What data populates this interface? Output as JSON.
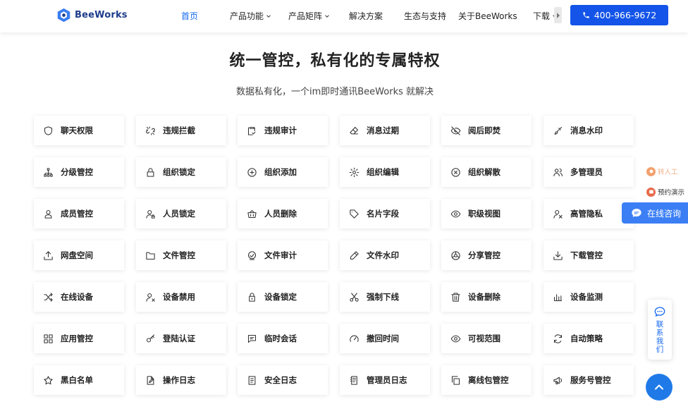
{
  "nav": {
    "brand": "BeeWorks",
    "items": [
      {
        "label": "首页",
        "active": true,
        "dropdown": false
      },
      {
        "label": "产品功能",
        "active": false,
        "dropdown": true
      },
      {
        "label": "产品矩阵",
        "active": false,
        "dropdown": true
      },
      {
        "label": "解决方案",
        "active": false,
        "dropdown": false
      },
      {
        "label": "生态与支持",
        "active": false,
        "dropdown": false
      },
      {
        "label": "关于BeeWorks",
        "active": false,
        "dropdown": false
      },
      {
        "label": "下载",
        "active": false,
        "dropdown": true
      }
    ],
    "phone": "400-966-9672",
    "accent": "#1454e8"
  },
  "hero": {
    "title": "统一管控，私有化的专属特权",
    "subtitle": "数据私有化，一个im即时通讯BeeWorks 就解决"
  },
  "features": [
    [
      {
        "label": "聊天权限",
        "icon": "shield-icon"
      },
      {
        "label": "违规拦截",
        "icon": "broken-link-icon"
      },
      {
        "label": "违规审计",
        "icon": "clipboard-check-icon"
      },
      {
        "label": "消息过期",
        "icon": "eraser-icon"
      },
      {
        "label": "阅后即焚",
        "icon": "eye-off-icon"
      },
      {
        "label": "消息水印",
        "icon": "brush-icon"
      }
    ],
    [
      {
        "label": "分级管控",
        "icon": "hierarchy-icon"
      },
      {
        "label": "组织锁定",
        "icon": "lock-icon"
      },
      {
        "label": "组织添加",
        "icon": "plus-circle-icon"
      },
      {
        "label": "组织编辑",
        "icon": "gear-icon"
      },
      {
        "label": "组织解散",
        "icon": "x-circle-icon"
      },
      {
        "label": "多管理员",
        "icon": "users-icon"
      }
    ],
    [
      {
        "label": "成员管控",
        "icon": "user-badge-icon"
      },
      {
        "label": "人员锁定",
        "icon": "user-lock-icon"
      },
      {
        "label": "人员删除",
        "icon": "basket-icon"
      },
      {
        "label": "名片字段",
        "icon": "tag-icon"
      },
      {
        "label": "职级视图",
        "icon": "eye-icon"
      },
      {
        "label": "高管隐私",
        "icon": "user-hide-icon"
      }
    ],
    [
      {
        "label": "网盘空间",
        "icon": "upload-icon"
      },
      {
        "label": "文件管控",
        "icon": "folder-icon"
      },
      {
        "label": "文件审计",
        "icon": "audit-icon"
      },
      {
        "label": "文件水印",
        "icon": "pencil-icon"
      },
      {
        "label": "分享管控",
        "icon": "share-icon"
      },
      {
        "label": "下载管控",
        "icon": "download-icon"
      }
    ],
    [
      {
        "label": "在线设备",
        "icon": "shuffle-icon"
      },
      {
        "label": "设备禁用",
        "icon": "user-x-icon"
      },
      {
        "label": "设备锁定",
        "icon": "padlock-icon"
      },
      {
        "label": "强制下线",
        "icon": "scissors-icon"
      },
      {
        "label": "设备删除",
        "icon": "trash-icon"
      },
      {
        "label": "设备监测",
        "icon": "bar-chart-icon"
      }
    ],
    [
      {
        "label": "应用管控",
        "icon": "apps-grid-icon"
      },
      {
        "label": "登陆认证",
        "icon": "key-icon"
      },
      {
        "label": "临时会话",
        "icon": "chat-icon"
      },
      {
        "label": "撤回时间",
        "icon": "speedometer-icon"
      },
      {
        "label": "可视范围",
        "icon": "eye-icon"
      },
      {
        "label": "自动策略",
        "icon": "refresh-icon"
      }
    ],
    [
      {
        "label": "黑白名单",
        "icon": "star-icon"
      },
      {
        "label": "操作日志",
        "icon": "edit-doc-icon"
      },
      {
        "label": "安全日志",
        "icon": "document-icon"
      },
      {
        "label": "管理员日志",
        "icon": "log-icon"
      },
      {
        "label": "离线包管控",
        "icon": "copy-icon"
      },
      {
        "label": "服务号管控",
        "icon": "megaphone-icon"
      }
    ]
  ],
  "side": {
    "human": "转人工",
    "demo": "预约演示",
    "consult": "在线咨询",
    "contact": "联系我们"
  }
}
